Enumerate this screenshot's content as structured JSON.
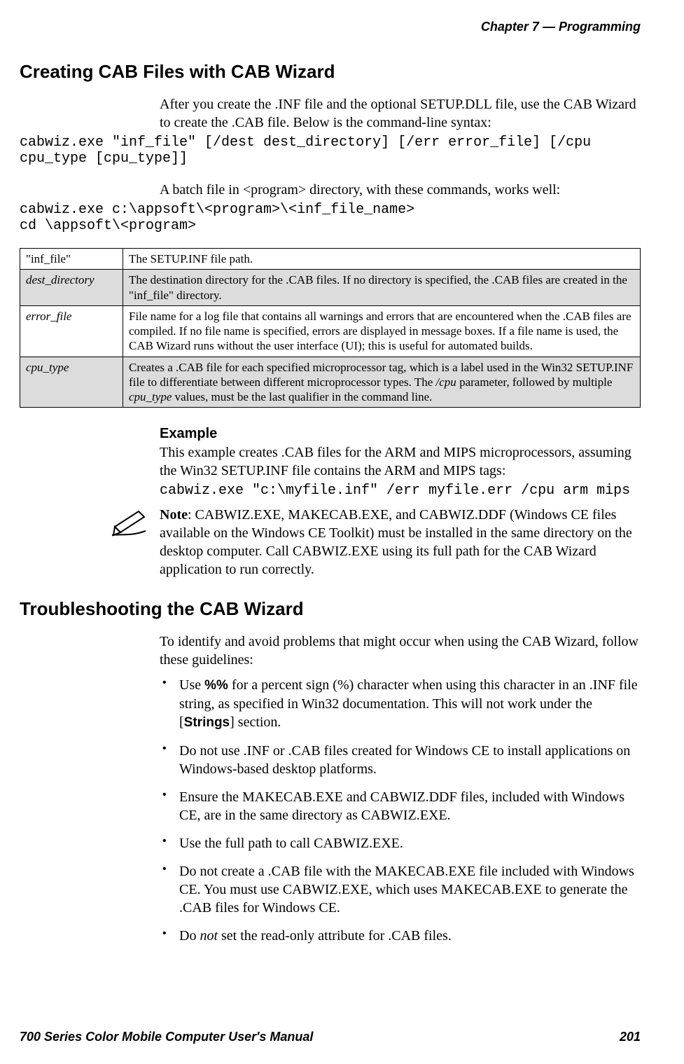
{
  "header": {
    "chapter_label": "Chapter",
    "chapter_number": "7",
    "dash": "—",
    "title": "Programming"
  },
  "section1": {
    "heading": "Creating CAB Files with CAB Wizard",
    "para1": "After you create the .INF file and the optional SETUP.DLL file, use the CAB Wizard to create the .CAB file. Below is the command-line syntax:",
    "code1": "cabwiz.exe \"inf_file\" [/dest dest_directory] [/err error_file] [/cpu cpu_type [cpu_type]]",
    "para2": "A batch file in <program> directory, with these commands, works well:",
    "code2": "cabwiz.exe c:\\appsoft\\<program>\\<inf_file_name>\ncd \\appsoft\\<program>"
  },
  "table": {
    "rows": [
      {
        "key": "\"inf_file\"",
        "desc": "The SETUP.INF file path."
      },
      {
        "key": "dest_directory",
        "desc": "The destination directory for the .CAB files. If no directory is specified, the .CAB files are created in the \"inf_file\" directory."
      },
      {
        "key": "error_file",
        "desc": "File name for a log file that contains all warnings and errors that are encountered when the .CAB files are compiled. If no file name is specified, errors are displayed in message boxes. If a file name is used, the CAB Wizard runs without the user interface (UI); this is useful for automated builds."
      },
      {
        "key": "cpu_type",
        "desc_pre": "Creates a .CAB file for each specified microprocessor tag, which is a label used in the Win32 SETUP.INF file to differentiate between different microprocessor types. The ",
        "cpu_param": "/cpu",
        "desc_mid": " parameter, followed by multiple ",
        "cpu_type_word": "cpu_type",
        "desc_post": " values, must be the last qualifier in the command line."
      }
    ]
  },
  "example": {
    "heading": "Example",
    "para": "This example creates .CAB files for the ARM and MIPS microprocessors, assuming the Win32 SETUP.INF file contains the ARM and MIPS tags:",
    "code": "cabwiz.exe \"c:\\myfile.inf\" /err myfile.err /cpu arm mips",
    "note_label": "Note",
    "note_text": ": CABWIZ.EXE, MAKECAB.EXE, and CABWIZ.DDF (Windows CE files available on the Windows CE Toolkit) must be installed in the same directory on the desktop computer. Call CABWIZ.EXE using its full path for the CAB Wizard application to run correctly."
  },
  "section2": {
    "heading": "Troubleshooting the CAB Wizard",
    "para": "To identify and avoid problems that might occur when using the CAB Wizard, follow these guidelines:",
    "bullets": [
      {
        "pre": "Use ",
        "b1": "%%",
        "mid": " for a percent sign (%) character when using this character in an .INF file string, as specified in Win32 documentation. This will not work under the [",
        "b2": "Strings",
        "post": "] section."
      },
      {
        "text": "Do not use .INF or .CAB files created for Windows CE to install applications on Windows-based desktop platforms."
      },
      {
        "text": "Ensure the MAKECAB.EXE and CABWIZ.DDF files, included with Windows CE, are in the same directory as CABWIZ.EXE."
      },
      {
        "text": "Use the full path to call CABWIZ.EXE."
      },
      {
        "text": "Do not create a .CAB file with the MAKECAB.EXE file included with Windows CE. You must use CABWIZ.EXE, which uses MAKECAB.EXE to generate the .CAB files for Windows CE."
      },
      {
        "pre": "Do ",
        "i": "not",
        "post": " set the read-only attribute for .CAB files."
      }
    ]
  },
  "footer": {
    "manual": "700 Series Color Mobile Computer User's Manual",
    "page": "201"
  }
}
